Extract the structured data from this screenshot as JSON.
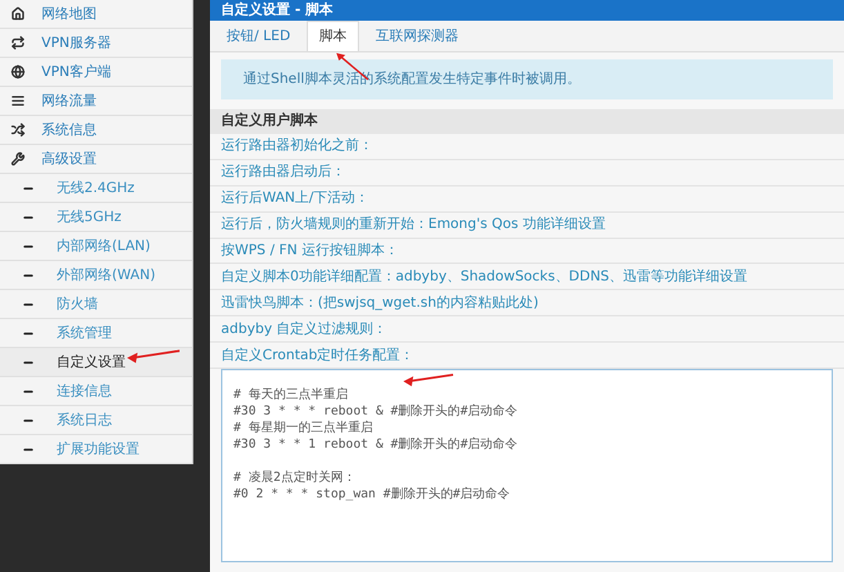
{
  "sidebar": {
    "items": [
      {
        "label": "网络地图",
        "selected": false
      },
      {
        "label": "VPN服务器",
        "selected": false
      },
      {
        "label": "VPN客户端",
        "selected": false
      },
      {
        "label": "网络流量",
        "selected": false
      },
      {
        "label": "系统信息",
        "selected": false
      },
      {
        "label": "高级设置",
        "selected": false,
        "children": [
          {
            "label": "无线2.4GHz",
            "selected": false
          },
          {
            "label": "无线5GHz",
            "selected": false
          },
          {
            "label": "内部网络(LAN)",
            "selected": false
          },
          {
            "label": "外部网络(WAN)",
            "selected": false
          },
          {
            "label": "防火墙",
            "selected": false
          },
          {
            "label": "系统管理",
            "selected": false
          },
          {
            "label": "自定义设置",
            "selected": true
          },
          {
            "label": "连接信息",
            "selected": false
          },
          {
            "label": "系统日志",
            "selected": false
          },
          {
            "label": "扩展功能设置",
            "selected": false
          }
        ]
      }
    ]
  },
  "panel": {
    "title": "自定义设置 - 脚本",
    "tabs": [
      {
        "label": "按钮/ LED",
        "selected": false
      },
      {
        "label": "脚本",
        "selected": true
      },
      {
        "label": "互联网探测器",
        "selected": false
      }
    ],
    "info": "通过Shell脚本灵活的系统配置发生特定事件时被调用。",
    "section_title": "自定义用户脚本",
    "scripts": [
      "运行路由器初始化之前：",
      "运行路由器启动后：",
      "运行后WAN上/下活动：",
      "运行后，防火墙规则的重新开始：Emong's Qos 功能详细设置",
      "按WPS / FN 运行按钮脚本：",
      "自定义脚本0功能详细配置：adbyby、ShadowSocks、DDNS、迅雷等功能详细设置",
      "迅雷快鸟脚本：(把swjsq_wget.sh的内容粘贴此处)",
      "adbyby 自定义过滤规则：",
      "自定义Crontab定时任务配置："
    ],
    "crontab_blocks": [
      [
        "# 每天的三点半重启",
        "#30 3 * * * reboot & #删除开头的#启动命令",
        "# 每星期一的三点半重启",
        "#30 3 * * 1 reboot & #删除开头的#启动命令"
      ],
      [
        "# 凌晨2点定时关网：",
        "#0 2 * * * stop_wan #删除开头的#启动命令"
      ]
    ]
  }
}
